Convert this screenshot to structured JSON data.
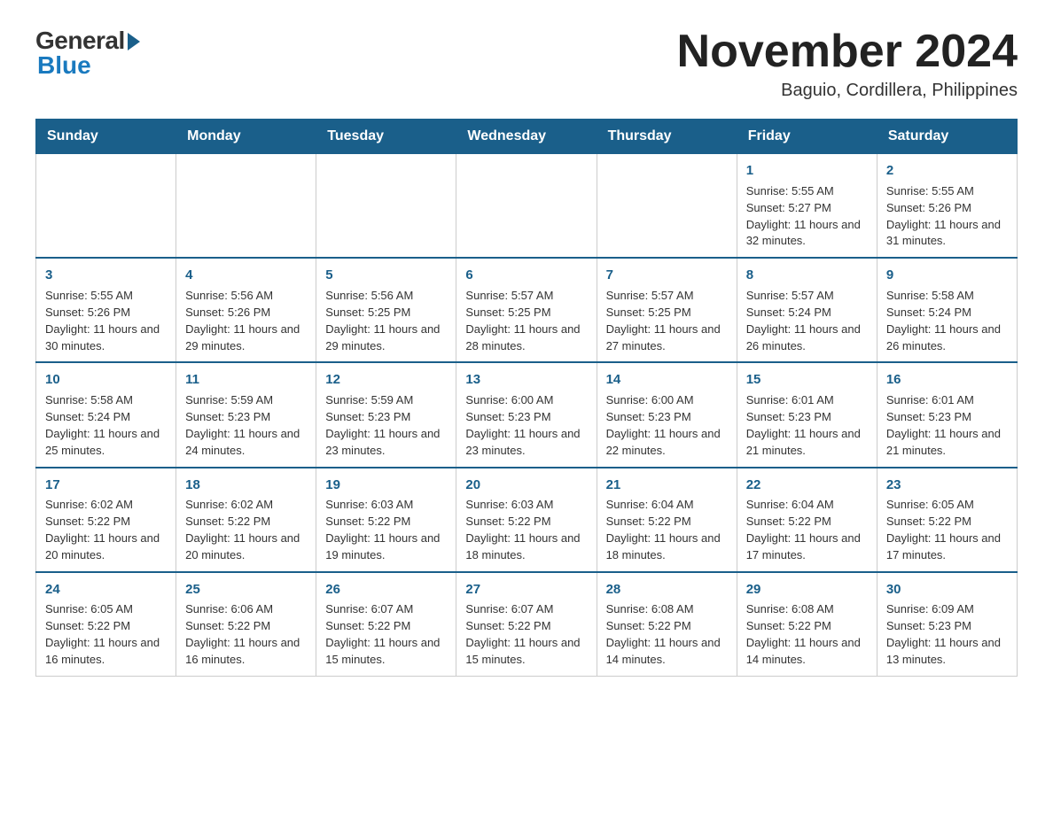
{
  "logo": {
    "general": "General",
    "blue": "Blue"
  },
  "title": "November 2024",
  "location": "Baguio, Cordillera, Philippines",
  "weekdays": [
    "Sunday",
    "Monday",
    "Tuesday",
    "Wednesday",
    "Thursday",
    "Friday",
    "Saturday"
  ],
  "rows": [
    [
      {
        "day": "",
        "info": ""
      },
      {
        "day": "",
        "info": ""
      },
      {
        "day": "",
        "info": ""
      },
      {
        "day": "",
        "info": ""
      },
      {
        "day": "",
        "info": ""
      },
      {
        "day": "1",
        "info": "Sunrise: 5:55 AM\nSunset: 5:27 PM\nDaylight: 11 hours and 32 minutes."
      },
      {
        "day": "2",
        "info": "Sunrise: 5:55 AM\nSunset: 5:26 PM\nDaylight: 11 hours and 31 minutes."
      }
    ],
    [
      {
        "day": "3",
        "info": "Sunrise: 5:55 AM\nSunset: 5:26 PM\nDaylight: 11 hours and 30 minutes."
      },
      {
        "day": "4",
        "info": "Sunrise: 5:56 AM\nSunset: 5:26 PM\nDaylight: 11 hours and 29 minutes."
      },
      {
        "day": "5",
        "info": "Sunrise: 5:56 AM\nSunset: 5:25 PM\nDaylight: 11 hours and 29 minutes."
      },
      {
        "day": "6",
        "info": "Sunrise: 5:57 AM\nSunset: 5:25 PM\nDaylight: 11 hours and 28 minutes."
      },
      {
        "day": "7",
        "info": "Sunrise: 5:57 AM\nSunset: 5:25 PM\nDaylight: 11 hours and 27 minutes."
      },
      {
        "day": "8",
        "info": "Sunrise: 5:57 AM\nSunset: 5:24 PM\nDaylight: 11 hours and 26 minutes."
      },
      {
        "day": "9",
        "info": "Sunrise: 5:58 AM\nSunset: 5:24 PM\nDaylight: 11 hours and 26 minutes."
      }
    ],
    [
      {
        "day": "10",
        "info": "Sunrise: 5:58 AM\nSunset: 5:24 PM\nDaylight: 11 hours and 25 minutes."
      },
      {
        "day": "11",
        "info": "Sunrise: 5:59 AM\nSunset: 5:23 PM\nDaylight: 11 hours and 24 minutes."
      },
      {
        "day": "12",
        "info": "Sunrise: 5:59 AM\nSunset: 5:23 PM\nDaylight: 11 hours and 23 minutes."
      },
      {
        "day": "13",
        "info": "Sunrise: 6:00 AM\nSunset: 5:23 PM\nDaylight: 11 hours and 23 minutes."
      },
      {
        "day": "14",
        "info": "Sunrise: 6:00 AM\nSunset: 5:23 PM\nDaylight: 11 hours and 22 minutes."
      },
      {
        "day": "15",
        "info": "Sunrise: 6:01 AM\nSunset: 5:23 PM\nDaylight: 11 hours and 21 minutes."
      },
      {
        "day": "16",
        "info": "Sunrise: 6:01 AM\nSunset: 5:23 PM\nDaylight: 11 hours and 21 minutes."
      }
    ],
    [
      {
        "day": "17",
        "info": "Sunrise: 6:02 AM\nSunset: 5:22 PM\nDaylight: 11 hours and 20 minutes."
      },
      {
        "day": "18",
        "info": "Sunrise: 6:02 AM\nSunset: 5:22 PM\nDaylight: 11 hours and 20 minutes."
      },
      {
        "day": "19",
        "info": "Sunrise: 6:03 AM\nSunset: 5:22 PM\nDaylight: 11 hours and 19 minutes."
      },
      {
        "day": "20",
        "info": "Sunrise: 6:03 AM\nSunset: 5:22 PM\nDaylight: 11 hours and 18 minutes."
      },
      {
        "day": "21",
        "info": "Sunrise: 6:04 AM\nSunset: 5:22 PM\nDaylight: 11 hours and 18 minutes."
      },
      {
        "day": "22",
        "info": "Sunrise: 6:04 AM\nSunset: 5:22 PM\nDaylight: 11 hours and 17 minutes."
      },
      {
        "day": "23",
        "info": "Sunrise: 6:05 AM\nSunset: 5:22 PM\nDaylight: 11 hours and 17 minutes."
      }
    ],
    [
      {
        "day": "24",
        "info": "Sunrise: 6:05 AM\nSunset: 5:22 PM\nDaylight: 11 hours and 16 minutes."
      },
      {
        "day": "25",
        "info": "Sunrise: 6:06 AM\nSunset: 5:22 PM\nDaylight: 11 hours and 16 minutes."
      },
      {
        "day": "26",
        "info": "Sunrise: 6:07 AM\nSunset: 5:22 PM\nDaylight: 11 hours and 15 minutes."
      },
      {
        "day": "27",
        "info": "Sunrise: 6:07 AM\nSunset: 5:22 PM\nDaylight: 11 hours and 15 minutes."
      },
      {
        "day": "28",
        "info": "Sunrise: 6:08 AM\nSunset: 5:22 PM\nDaylight: 11 hours and 14 minutes."
      },
      {
        "day": "29",
        "info": "Sunrise: 6:08 AM\nSunset: 5:22 PM\nDaylight: 11 hours and 14 minutes."
      },
      {
        "day": "30",
        "info": "Sunrise: 6:09 AM\nSunset: 5:23 PM\nDaylight: 11 hours and 13 minutes."
      }
    ]
  ]
}
